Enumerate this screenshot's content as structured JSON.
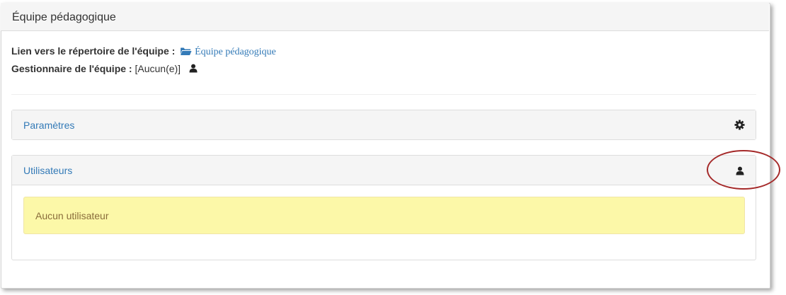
{
  "panel": {
    "title": "Équipe pédagogique"
  },
  "info": {
    "folder_label": "Lien vers le répertoire de l'équipe :",
    "folder_link": "Équipe pédagogique",
    "manager_label": "Gestionnaire de l'équipe :",
    "manager_value": "[Aucun(e)]"
  },
  "parametres": {
    "title": "Paramètres",
    "icon": "gear-icon"
  },
  "utilisateurs": {
    "title": "Utilisateurs",
    "icon": "user-icon",
    "empty_message": "Aucun utilisateur"
  },
  "colors": {
    "link": "#337ab7",
    "alert_bg": "#fcf8a8",
    "alert_text": "#8a6d3b",
    "highlight": "#a52a2a"
  }
}
